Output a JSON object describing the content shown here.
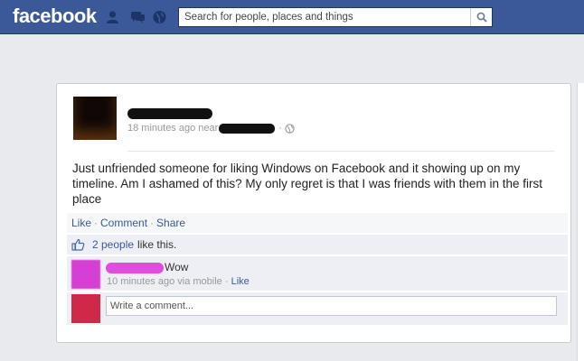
{
  "topbar": {
    "logo": "facebook",
    "search_placeholder": "Search for people, places and things",
    "icons": [
      "friend-requests-icon",
      "messages-icon",
      "notifications-globe-icon",
      "search-icon"
    ]
  },
  "post": {
    "time": "18 minutes ago near",
    "privacy_icon": "globe-icon",
    "text": "Just unfriended someone for liking Windows on Facebook and it showing up on my timeline. Am I ashamed of this? My only regret is that I was friends with them in the first place",
    "actions": {
      "like": "Like",
      "comment": "Comment",
      "share": "Share",
      "separator": "·"
    },
    "likes": {
      "people": "2 people",
      "rest": "like this."
    }
  },
  "comment": {
    "text": "Wow",
    "meta": "10 minutes ago via mobile ·",
    "like": "Like"
  },
  "composer": {
    "placeholder": "Write a comment..."
  },
  "colors": {
    "brand": "#3b5998",
    "background": "#e9eaed"
  }
}
